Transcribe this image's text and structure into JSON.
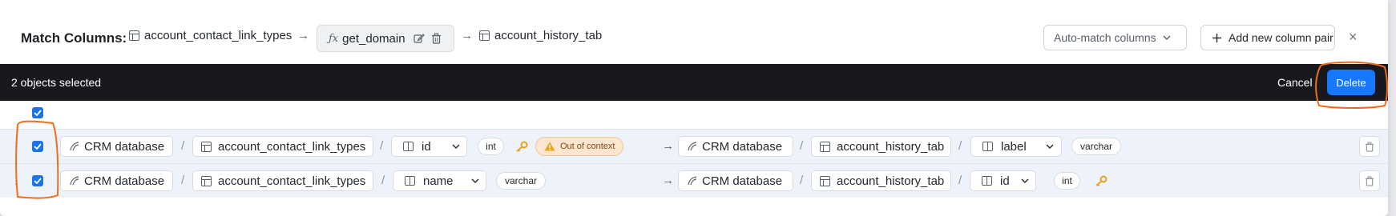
{
  "header": {
    "title": "Match Columns:",
    "source_table": "account_contact_link_types",
    "function_name": "get_domain",
    "target_table": "account_history_tab",
    "automatch_label": "Auto-match columns",
    "add_pair_label": "Add new column pair"
  },
  "selection_bar": {
    "count_text": "2 objects selected",
    "cancel_label": "Cancel",
    "delete_label": "Delete"
  },
  "rows": [
    {
      "left": {
        "database": "CRM database",
        "table": "account_contact_link_types",
        "column": "id",
        "type": "int",
        "warning": "Out of context"
      },
      "right": {
        "database": "CRM database",
        "table": "account_history_tab",
        "column": "label",
        "type": "varchar"
      }
    },
    {
      "left": {
        "database": "CRM database",
        "table": "account_contact_link_types",
        "column": "name",
        "type": "varchar"
      },
      "right": {
        "database": "CRM database",
        "table": "account_history_tab",
        "column": "id",
        "type": "int"
      }
    }
  ],
  "symbols": {
    "arrow": "→",
    "slash": "/",
    "fx": "ƒx",
    "close": "×"
  },
  "colors": {
    "accent": "#1677ff",
    "selection_bar": "#17191e",
    "row_bg": "#eef3fb",
    "warning_bg": "#fde6cf",
    "key": "#e8a317",
    "annotation": "#ef6c1a"
  }
}
